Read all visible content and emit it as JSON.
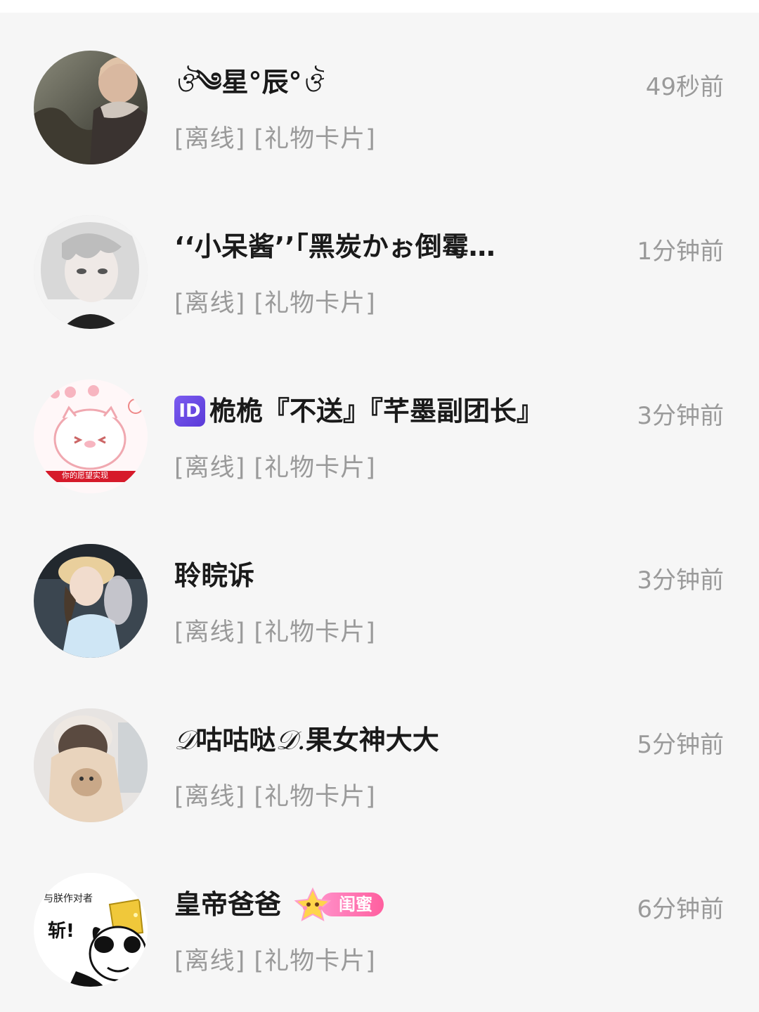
{
  "conversations": [
    {
      "name_prefix": "ঔ",
      "name": "༄星°辰°",
      "name_suffix": "ঔ",
      "preview": "[离线] [礼物卡片]",
      "time": "49秒前",
      "avatar_icon": "avatar-photo-dark-coat"
    },
    {
      "name": "‘‘小呆酱’’「黑炭かぉ倒霉…",
      "preview": "[离线] [礼物卡片]",
      "time": "1分钟前",
      "avatar_icon": "avatar-anime-white-hair"
    },
    {
      "badge": "ID",
      "name": "桅桅『不送』『芊墨副团长』",
      "preview": "[离线] [礼物卡片]",
      "time": "3分钟前",
      "avatar_icon": "avatar-cartoon-pig",
      "avatar_banner": "你的愿望实现"
    },
    {
      "name": "聆睆诉",
      "preview": "[离线] [礼物卡片]",
      "time": "3分钟前",
      "avatar_icon": "avatar-photo-girl-hat"
    },
    {
      "name_prefix": "𝒟",
      "name": "咕咕哒",
      "name_mid": "𝒟.",
      "name_suffix": "果女神大大",
      "preview": "[离线] [礼物卡片]",
      "time": "5分钟前",
      "avatar_icon": "avatar-photo-girl-bear"
    },
    {
      "name": "皇帝爸爸",
      "tag": "闺蜜",
      "preview": "[离线] [礼物卡片]",
      "time": "6分钟前",
      "avatar_icon": "avatar-meme-panda",
      "avatar_caption": "与朕作对者",
      "avatar_text": "斩!"
    }
  ]
}
